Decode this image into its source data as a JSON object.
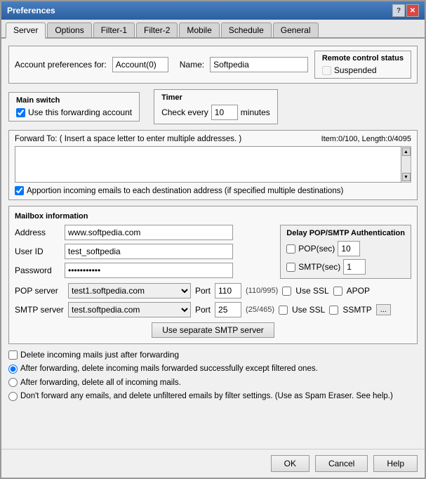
{
  "window": {
    "title": "Preferences"
  },
  "titlebar": {
    "help_label": "?",
    "close_label": "✕"
  },
  "tabs": [
    {
      "id": "server",
      "label": "Server",
      "active": true
    },
    {
      "id": "options",
      "label": "Options"
    },
    {
      "id": "filter1",
      "label": "Filter-1"
    },
    {
      "id": "filter2",
      "label": "Filter-2"
    },
    {
      "id": "mobile",
      "label": "Mobile"
    },
    {
      "id": "schedule",
      "label": "Schedule"
    },
    {
      "id": "general",
      "label": "General"
    }
  ],
  "account_prefs": {
    "section_label": "Account preferences for:",
    "account_id": "Account(0)",
    "name_label": "Name:",
    "account_name": "Softpedia",
    "remote_label": "Remote control status",
    "suspended_label": "Suspended"
  },
  "main_switch": {
    "group_label": "Main switch",
    "checkbox_label": "Use this forwarding account",
    "checked": true
  },
  "timer": {
    "group_label": "Timer",
    "check_label": "Check every",
    "value": "10",
    "unit": "minutes"
  },
  "forward_to": {
    "label": "Forward To: ( Insert a space letter to enter multiple addresses. )",
    "counter": "Item:0/100,  Length:0/4095",
    "textarea_value": ""
  },
  "aportion": {
    "label": "Apportion incoming emails to each destination address (if specified multiple destinations)",
    "checked": true
  },
  "mailbox": {
    "section_label": "Mailbox information",
    "address_label": "Address",
    "address_value": "www.softpedia.com",
    "userid_label": "User ID",
    "userid_value": "test_softpedia",
    "password_label": "Password",
    "password_value": "●●●●●●●●●"
  },
  "delay_auth": {
    "title": "Delay POP/SMTP Authentication",
    "pop_label": "POP(sec)",
    "pop_value": "10",
    "smtp_label": "SMTP(sec)",
    "smtp_value": "1",
    "pop_checked": false,
    "smtp_checked": false
  },
  "pop_server": {
    "label": "POP server",
    "value": "test1.softpedia.com",
    "port_label": "Port",
    "port_value": "110",
    "hint": "(110/995)",
    "ssl_label": "Use SSL",
    "apop_label": "APOP",
    "ssl_checked": false,
    "apop_checked": false
  },
  "smtp_server": {
    "label": "SMTP server",
    "value": "test.softpedia.com",
    "port_label": "Port",
    "port_value": "25",
    "hint": "(25/465)",
    "ssl_label": "Use SSL",
    "ssmtp_label": "SSMTP",
    "extra_label": "...",
    "ssl_checked": false,
    "ssmtp_checked": false
  },
  "sep_smtp": {
    "button_label": "Use separate SMTP server"
  },
  "delete_options": {
    "checkbox_label": "Delete incoming mails just after forwarding",
    "checked": false,
    "radio1_label": "After forwarding, delete incoming mails forwarded successfully except filtered ones.",
    "radio2_label": "After forwarding, delete all of incoming mails.",
    "radio3_label": "Don't forward any emails, and delete unfiltered emails by filter settings. (Use as Spam Eraser. See help.)",
    "selected": "radio1"
  },
  "footer": {
    "ok_label": "OK",
    "cancel_label": "Cancel",
    "help_label": "Help"
  }
}
